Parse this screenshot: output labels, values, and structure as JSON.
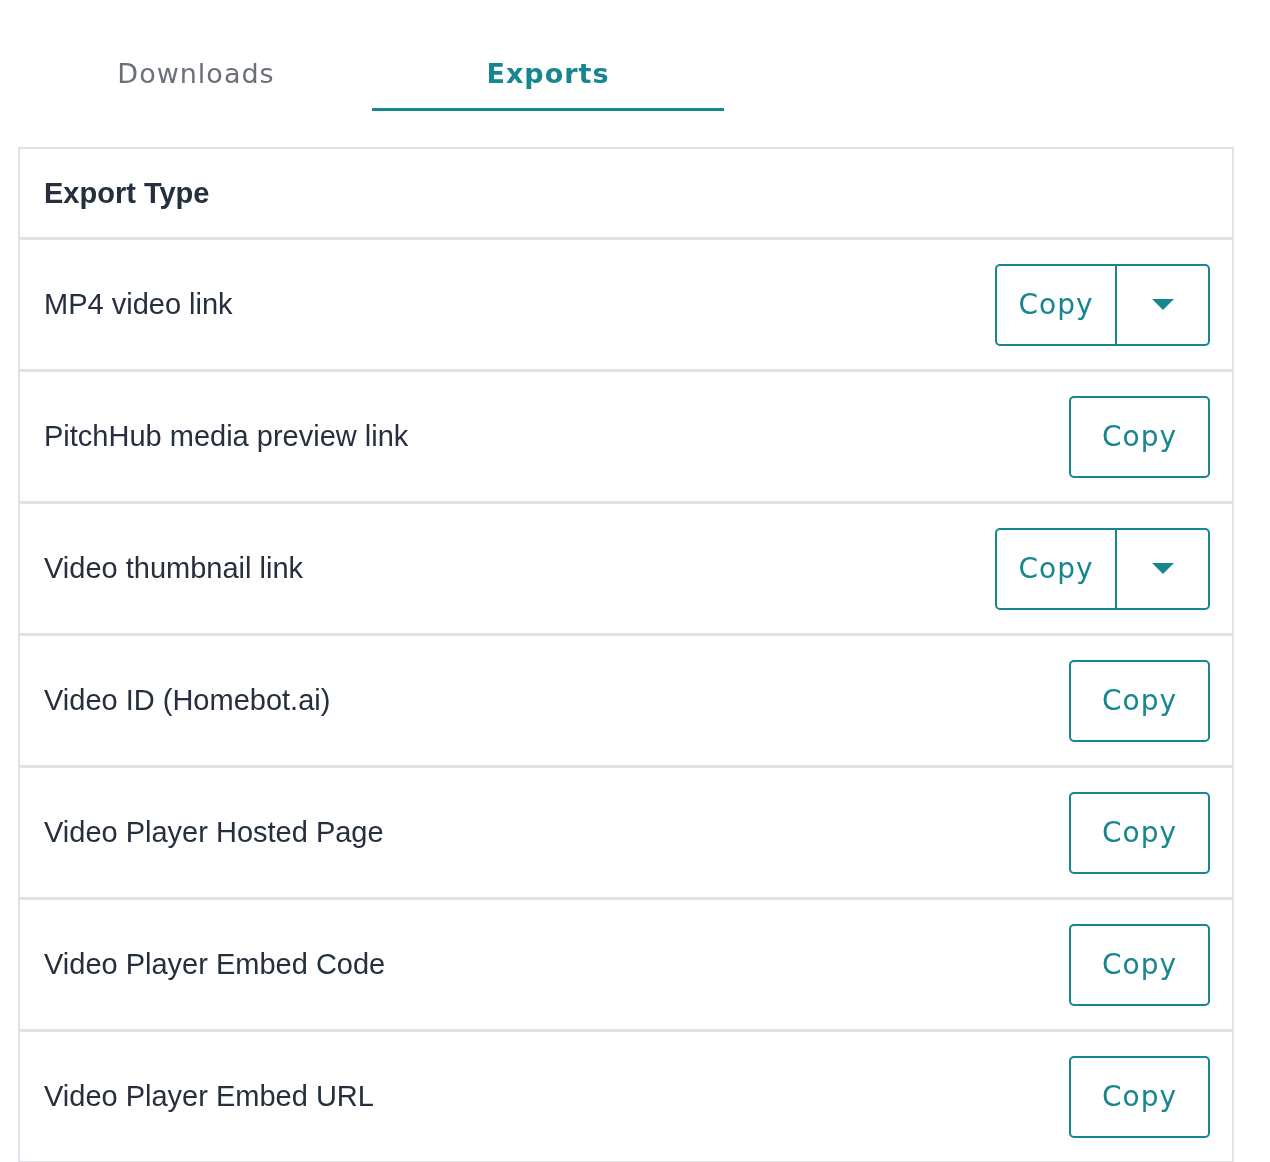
{
  "tabs": [
    {
      "label": "Downloads",
      "selected": false
    },
    {
      "label": "Exports",
      "selected": true
    }
  ],
  "table": {
    "header": "Export Type",
    "rows": [
      {
        "label": "MP4 video link",
        "kind": "split",
        "button": "Copy"
      },
      {
        "label": "PitchHub media preview link",
        "kind": "single",
        "button": "Copy"
      },
      {
        "label": "Video thumbnail link",
        "kind": "split",
        "button": "Copy"
      },
      {
        "label": "Video ID (Homebot.ai)",
        "kind": "single",
        "button": "Copy"
      },
      {
        "label": "Video Player Hosted Page",
        "kind": "single",
        "button": "Copy"
      },
      {
        "label": "Video Player Embed Code",
        "kind": "single",
        "button": "Copy"
      },
      {
        "label": "Video Player Embed URL",
        "kind": "single",
        "button": "Copy"
      }
    ]
  }
}
